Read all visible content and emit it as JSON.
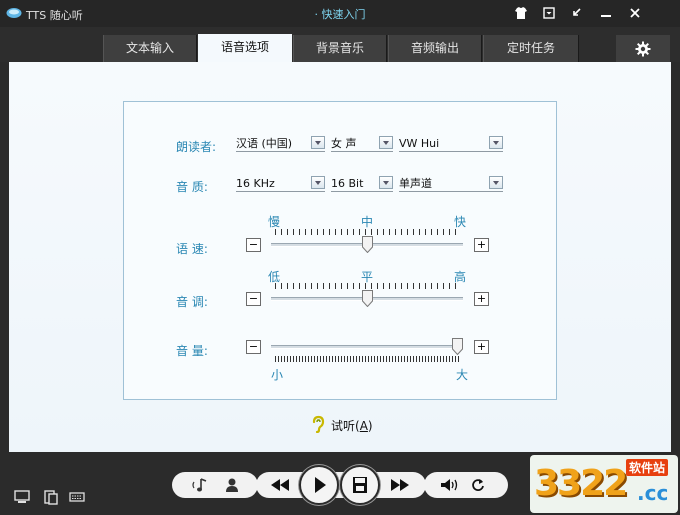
{
  "app": {
    "title": "TTS 随心听",
    "quick_start": "· 快速入门"
  },
  "window_buttons": [
    {
      "name": "skin-button",
      "icon": "tshirt-icon"
    },
    {
      "name": "menu-button",
      "icon": "menu-box-icon"
    },
    {
      "name": "mini-mode-button",
      "icon": "shrink-arrow-icon"
    },
    {
      "name": "minimize-button",
      "icon": "minimize-icon"
    },
    {
      "name": "close-button",
      "icon": "close-icon"
    }
  ],
  "tabs": [
    {
      "label": "文本输入",
      "active": false
    },
    {
      "label": "语音选项",
      "active": true
    },
    {
      "label": "背景音乐",
      "active": false
    },
    {
      "label": "音频输出",
      "active": false
    },
    {
      "label": "定时任务",
      "active": false
    }
  ],
  "settings_icon": "gear-icon",
  "voice_options": {
    "reader_label": "朗读者:",
    "language": "汉语 (中国)",
    "gender": "女 声",
    "voice": "VW Hui",
    "quality_label": "音   质:",
    "sample_rate": "16 KHz",
    "bit_depth": "16 Bit",
    "channels": "单声道",
    "speed": {
      "label": "语   速:",
      "min": "慢",
      "mid": "中",
      "max": "快",
      "value": 0.5
    },
    "pitch": {
      "label": "音   调:",
      "min": "低",
      "mid": "平",
      "max": "高",
      "value": 0.5
    },
    "volume": {
      "label": "音   量:",
      "min": "小",
      "max": "大",
      "value": 1.0
    },
    "minus": "−",
    "plus": "+"
  },
  "listen_button": {
    "label": "试听",
    "shortcut": "A",
    "icon": "ear-icon"
  },
  "bottom_left_icons": [
    "computer-icon",
    "clipboard-icon",
    "keyboard-icon"
  ],
  "player_icons": [
    "music-note-icon",
    "person-icon",
    "rewind-icon",
    "play-icon",
    "save-icon",
    "fast-forward-icon",
    "speaker-icon",
    "repeat-icon"
  ],
  "watermark": {
    "number": "3322",
    "site": "软件站",
    "domain": ".cc"
  },
  "colors": {
    "accent_text": "#2a87b3",
    "title_accent": "#7fd5f0",
    "dark_bg": "#2b2b2b"
  }
}
